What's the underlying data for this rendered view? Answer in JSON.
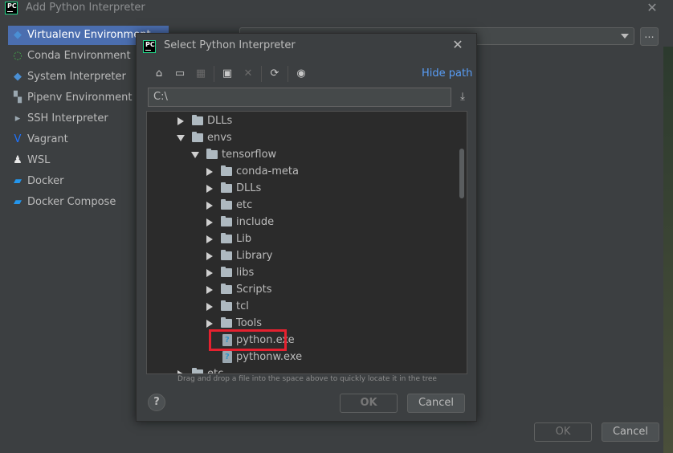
{
  "outer": {
    "title": "Add Python Interpreter",
    "close": "✕",
    "dots": "...",
    "ok_label": "OK",
    "cancel_label": "Cancel"
  },
  "sidebar": {
    "items": [
      {
        "label": "Virtualenv Environment",
        "icon": "python-icon",
        "glyph": "◆",
        "color": "#4a8fd4"
      },
      {
        "label": "Conda Environment",
        "icon": "conda-icon",
        "glyph": "◌",
        "color": "#43b049"
      },
      {
        "label": "System Interpreter",
        "icon": "python-icon",
        "glyph": "◆",
        "color": "#4a8fd4"
      },
      {
        "label": "Pipenv Environment",
        "icon": "pipenv-icon",
        "glyph": "▚",
        "color": "#9aa7b0"
      },
      {
        "label": "SSH Interpreter",
        "icon": "terminal-icon",
        "glyph": "▸",
        "color": "#9aa7b0"
      },
      {
        "label": "Vagrant",
        "icon": "vagrant-icon",
        "glyph": "V",
        "color": "#1e73ff"
      },
      {
        "label": "WSL",
        "icon": "linux-penguin-icon",
        "glyph": "♟",
        "color": "#e8e8e8"
      },
      {
        "label": "Docker",
        "icon": "docker-icon",
        "glyph": "▰",
        "color": "#2496ed"
      },
      {
        "label": "Docker Compose",
        "icon": "docker-icon",
        "glyph": "▰",
        "color": "#2496ed"
      }
    ]
  },
  "dialog": {
    "title": "Select Python Interpreter",
    "close": "✕",
    "hide_path": "Hide path",
    "path_value": "C:\\",
    "hint": "Drag and drop a file into the space above to quickly locate it in the tree",
    "help": "?",
    "ok_label": "OK",
    "cancel_label": "Cancel",
    "toolbar": [
      {
        "icon": "home-icon",
        "glyph": "⌂"
      },
      {
        "icon": "desktop-icon",
        "glyph": "▭"
      },
      {
        "icon": "project-icon",
        "glyph": "▦"
      },
      {
        "icon": "new-folder-icon",
        "glyph": "▣"
      },
      {
        "icon": "delete-icon",
        "glyph": "✕"
      },
      {
        "icon": "refresh-icon",
        "glyph": "⟳"
      },
      {
        "icon": "show-hidden-icon",
        "glyph": "◉"
      }
    ]
  },
  "tree": {
    "nodes": [
      {
        "label": "DLLs",
        "kind": "folder",
        "state": "collapsed",
        "depth": 0
      },
      {
        "label": "envs",
        "kind": "folder",
        "state": "expanded",
        "depth": 0
      },
      {
        "label": "tensorflow",
        "kind": "folder",
        "state": "expanded",
        "depth": 1
      },
      {
        "label": "conda-meta",
        "kind": "folder",
        "state": "collapsed",
        "depth": 2
      },
      {
        "label": "DLLs",
        "kind": "folder",
        "state": "collapsed",
        "depth": 2
      },
      {
        "label": "etc",
        "kind": "folder",
        "state": "collapsed",
        "depth": 2
      },
      {
        "label": "include",
        "kind": "folder",
        "state": "collapsed",
        "depth": 2
      },
      {
        "label": "Lib",
        "kind": "folder",
        "state": "collapsed",
        "depth": 2
      },
      {
        "label": "Library",
        "kind": "folder",
        "state": "collapsed",
        "depth": 2
      },
      {
        "label": "libs",
        "kind": "folder",
        "state": "collapsed",
        "depth": 2
      },
      {
        "label": "Scripts",
        "kind": "folder",
        "state": "collapsed",
        "depth": 2
      },
      {
        "label": "tcl",
        "kind": "folder",
        "state": "collapsed",
        "depth": 2
      },
      {
        "label": "Tools",
        "kind": "folder",
        "state": "collapsed",
        "depth": 2
      },
      {
        "label": "python.exe",
        "kind": "file",
        "state": "leaf",
        "depth": 2
      },
      {
        "label": "pythonw.exe",
        "kind": "file",
        "state": "leaf",
        "depth": 2
      },
      {
        "label": "etc",
        "kind": "folder",
        "state": "collapsed",
        "depth": 0
      }
    ]
  },
  "colors": {
    "background": "#3c3f41",
    "selection": "#4b6eaf",
    "link": "#589df6",
    "highlight_box": "#e5212f"
  }
}
